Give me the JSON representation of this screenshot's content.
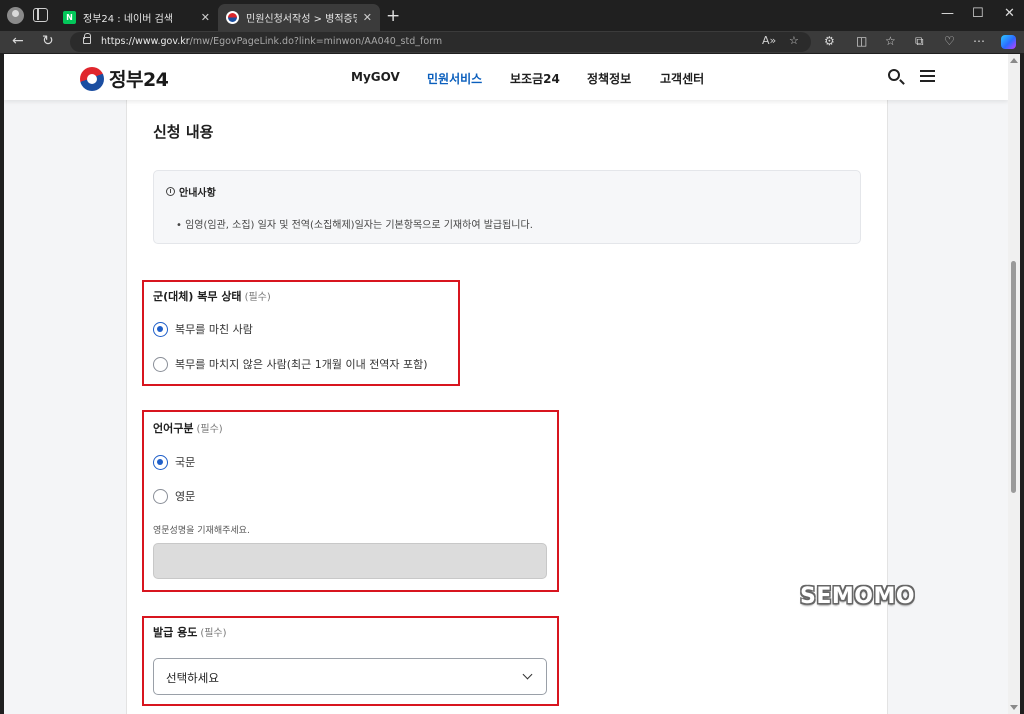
{
  "browser": {
    "tabs": [
      {
        "title": "정부24 : 네이버 검색",
        "favicon": "naver-favicon",
        "active": false
      },
      {
        "title": "민원신청서작성 > 병적증명서 발",
        "favicon": "gov24-favicon",
        "active": true
      }
    ],
    "url_host": "https://www.gov.kr",
    "url_path": "/mw/EgovPageLink.do?link=minwon/AA040_std_form"
  },
  "header": {
    "logo_text": "정부24",
    "nav": [
      "MyGOV",
      "민원서비스",
      "보조금24",
      "정책정보",
      "고객센터"
    ],
    "active_nav": "민원서비스"
  },
  "form": {
    "section_title": "신청 내용",
    "notice": {
      "title": "안내사항",
      "body": "• 임영(임관, 소집) 일자 및 전역(소집해제)일자는 기본항목으로 기재하여 발급됩니다."
    },
    "service_status": {
      "label": "군(대체) 복무 상태",
      "required": "(필수)",
      "options": [
        "복무를 마친 사람",
        "복무를 마치지 않은 사람(최근 1개월 이내 전역자 포함)"
      ],
      "selected": 0
    },
    "language": {
      "label": "언어구분",
      "required": "(필수)",
      "options": [
        "국문",
        "영문"
      ],
      "selected": 0,
      "english_name_hint": "영문성명을 기재해주세요.",
      "english_name_value": ""
    },
    "purpose": {
      "label": "발급 용도",
      "required": "(필수)",
      "selected_text": "선택하세요"
    }
  },
  "watermark": "SEMOMO",
  "colors": {
    "accent": "#1f5fc9",
    "active_nav": "#0b5fbd",
    "highlight_box": "#d8151f"
  }
}
